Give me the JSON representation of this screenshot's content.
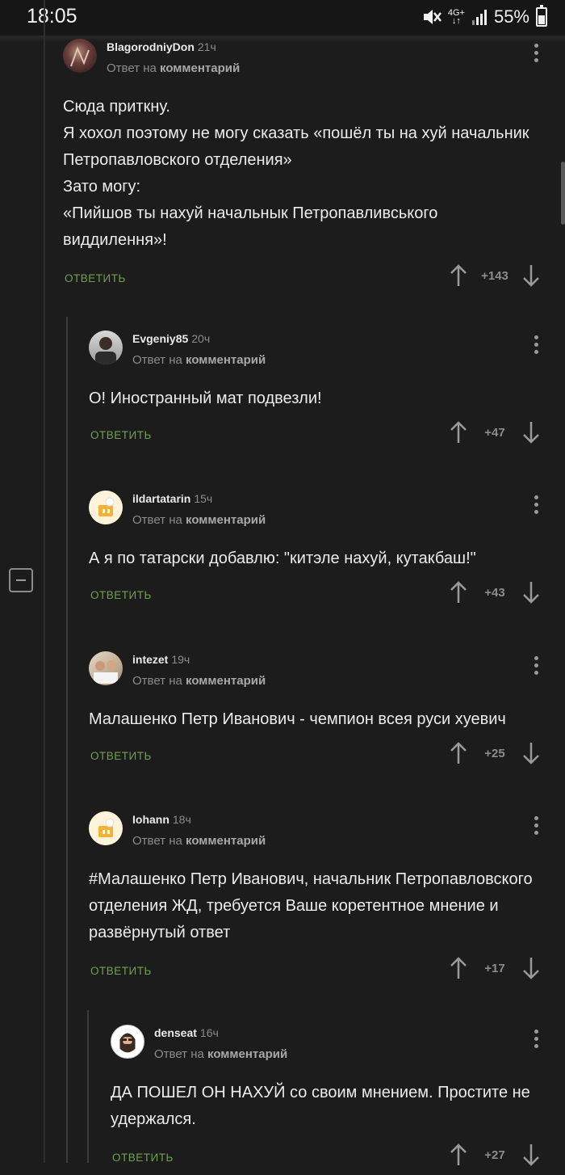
{
  "statusbar": {
    "time": "18:05",
    "network_top": "4G+",
    "network_bottom": "↓↑",
    "battery": "55%",
    "battery_level": 0.55
  },
  "comments": [
    {
      "username": "BlagorodniyDon",
      "age": "21ч",
      "reply_prefix": "Ответ на",
      "reply_target": "комментарий",
      "text": "Сюда приткну.\nЯ хохол поэтому не могу сказать «пошёл ты на хуй начальник Петропавловского отделения»\nЗато могу:\n«Пийшов ты нахуй начальнык Петропавливського виддилення»!",
      "reply_label": "ОТВЕТИТЬ",
      "score": "+143"
    },
    {
      "username": "Evgeniy85",
      "age": "20ч",
      "reply_prefix": "Ответ на",
      "reply_target": "комментарий",
      "text": "О! Иностранный мат подвезли!",
      "reply_label": "ОТВЕТИТЬ",
      "score": "+47"
    },
    {
      "username": "ildartatarin",
      "age": "15ч",
      "reply_prefix": "Ответ на",
      "reply_target": "комментарий",
      "text": "А я по татарски добавлю: \"китэле нахуй, кутакбаш!\"",
      "reply_label": "ОТВЕТИТЬ",
      "score": "+43"
    },
    {
      "username": "intezet",
      "age": "19ч",
      "reply_prefix": "Ответ на",
      "reply_target": "комментарий",
      "text": "Малашенко Петр Иванович - чемпион всея руси хуевич",
      "reply_label": "ОТВЕТИТЬ",
      "score": "+25"
    },
    {
      "username": "Iohann",
      "age": "18ч",
      "reply_prefix": "Ответ на",
      "reply_target": "комментарий",
      "text": "#Малашенко Петр Иванович, начальник Петропавловского отделения ЖД, требуется Ваше коретентное мнение и развёрнутый ответ",
      "reply_label": "ОТВЕТИТЬ",
      "score": "+17"
    },
    {
      "username": "denseat",
      "age": "16ч",
      "reply_prefix": "Ответ на",
      "reply_target": "комментарий",
      "text": "ДА ПОШЕЛ ОН НАХУЙ со своим мнением. Простите не удержался.",
      "reply_label": "ОТВЕТИТЬ",
      "score": "+27"
    }
  ],
  "icons": {
    "vote_up": "arrow-up-icon",
    "vote_down": "arrow-down-icon",
    "menu": "kebab-menu-icon",
    "collapse": "collapse-thread-icon"
  },
  "colors": {
    "background": "#1c1c1c",
    "reply_accent": "#6fa24a",
    "muted": "#8c8c8c"
  }
}
